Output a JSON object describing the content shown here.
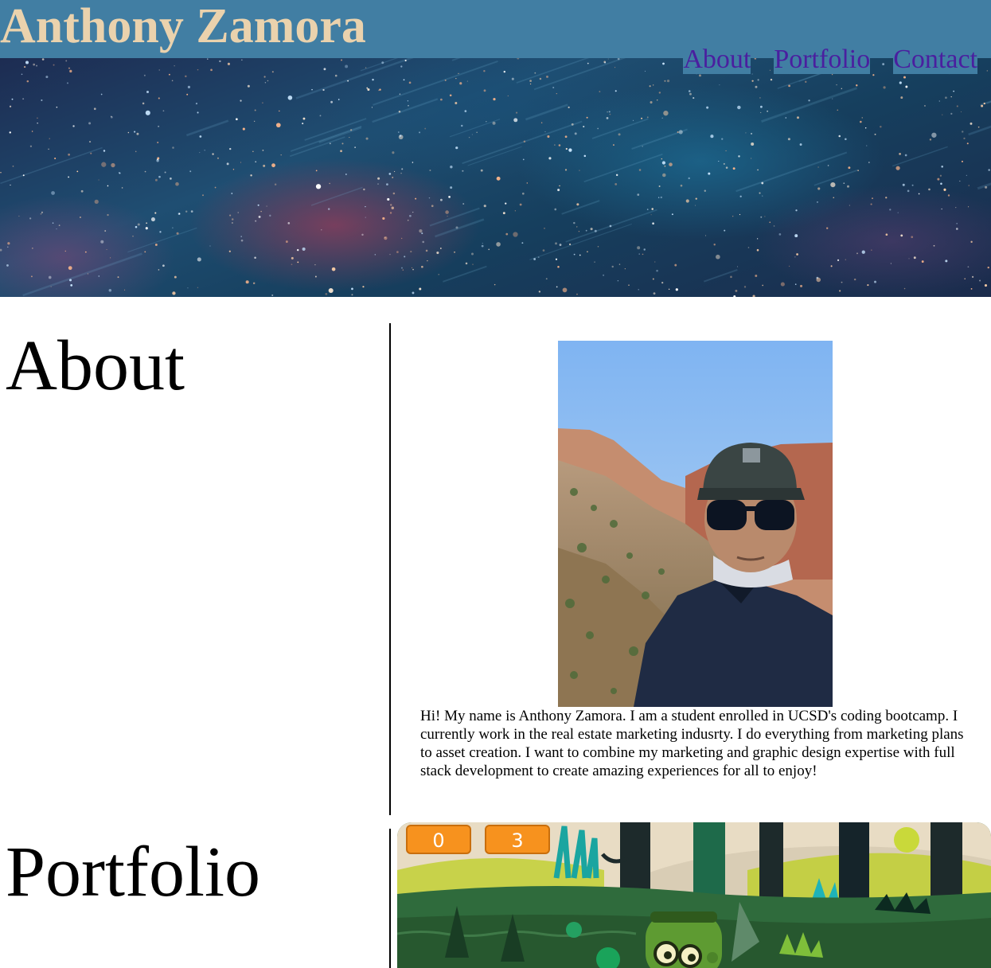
{
  "header": {
    "title": "Anthony Zamora",
    "nav": [
      {
        "label": "About"
      },
      {
        "label": "Portfolio"
      },
      {
        "label": "Contact"
      }
    ]
  },
  "about": {
    "heading": "About",
    "photo_icon": "profile-photo",
    "bio": "Hi! My name is Anthony Zamora. I am a student enrolled in UCSD's coding bootcamp. I currently work in the real estate marketing indusrty. I do everything from marketing plans to asset creation. I want to combine my marketing and graphic design expertise with full stack development to create amazing experiences for all to enjoy!"
  },
  "portfolio": {
    "heading": "Portfolio",
    "project_preview": {
      "scores": [
        "0",
        "3"
      ]
    }
  },
  "colors": {
    "header_bg": "#417ea3",
    "title": "#ead2ad",
    "nav_link": "#4a1f9f"
  }
}
